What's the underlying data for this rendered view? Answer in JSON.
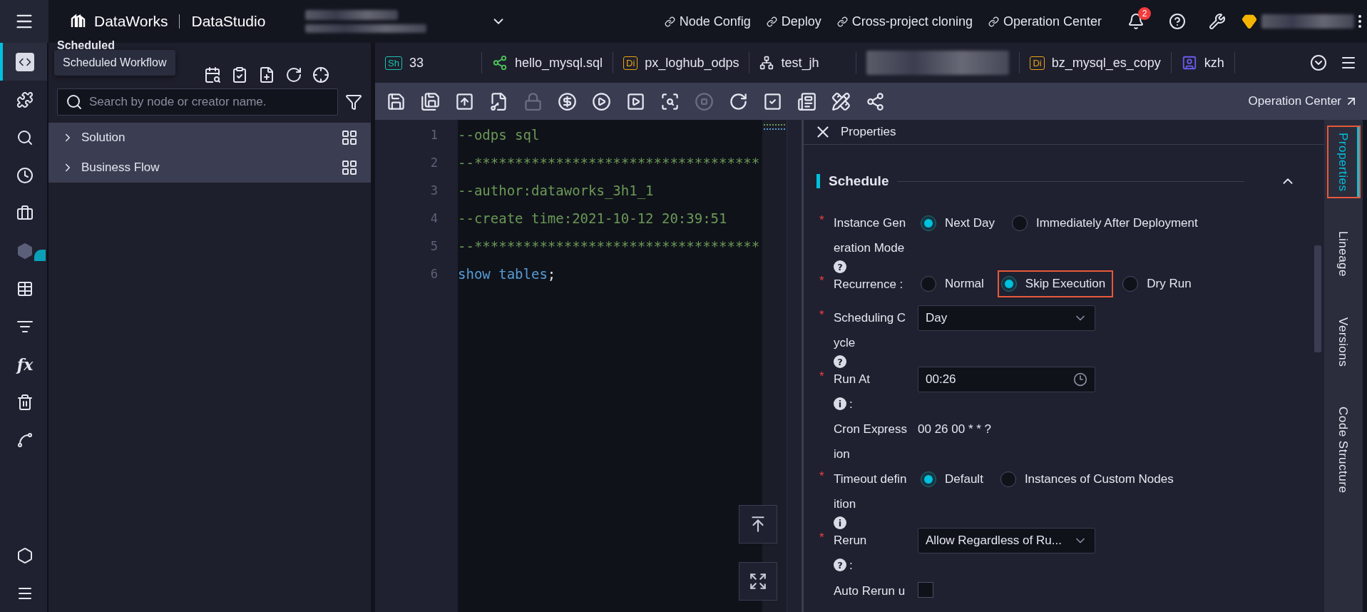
{
  "top_bar": {
    "brand": "DataWorks",
    "module": "DataStudio",
    "links": [
      "Node Config",
      "Deploy",
      "Cross-project cloning",
      "Operation Center"
    ],
    "notification_count": "2"
  },
  "activity_bar": [
    {
      "selected": true
    },
    {
      "selected": false
    },
    {
      "selected": false
    },
    {
      "selected": false
    },
    {
      "selected": false
    },
    {
      "selected": false,
      "disabled": true
    },
    {
      "selected": false
    },
    {
      "selected": false
    },
    {
      "selected": false,
      "glyph": "fx"
    },
    {
      "selected": false
    },
    {
      "selected": false
    }
  ],
  "workflow_panel": {
    "title": "Scheduled",
    "tooltip": "Scheduled Workflow",
    "search": {
      "placeholder": "Search by node or creator name."
    },
    "tree": [
      {
        "label": "Solution",
        "expanded": false
      },
      {
        "label": "Business Flow",
        "expanded": false
      }
    ]
  },
  "file_tabs": [
    {
      "kind": "shell",
      "badge": "Sh",
      "label": "33"
    },
    {
      "kind": "mysql",
      "label": "hello_mysql.sql"
    },
    {
      "kind": "di",
      "badge": "Di",
      "label": "px_loghub_odps"
    },
    {
      "kind": "flow",
      "label": "test_jh"
    },
    {
      "kind": "redacted"
    },
    {
      "kind": "di",
      "badge": "Di",
      "label": "bz_mysql_es_copy"
    },
    {
      "kind": "user",
      "label": "kzh"
    }
  ],
  "toolbar": {
    "buttons": [
      {
        "disabled": false
      },
      {
        "disabled": false
      },
      {
        "disabled": false
      },
      {
        "disabled": false
      },
      {
        "disabled": true
      },
      {
        "disabled": false
      },
      {
        "disabled": false
      },
      {
        "disabled": false
      },
      {
        "disabled": false
      },
      {
        "disabled": true
      },
      {
        "disabled": false
      },
      {
        "disabled": false
      },
      {
        "disabled": false
      },
      {
        "disabled": false
      },
      {
        "disabled": false
      }
    ],
    "link": "Operation Center"
  },
  "editor": {
    "lines": [
      {
        "number": "1",
        "tokens": [
          {
            "kind": "comment",
            "text": "--odps sql"
          }
        ]
      },
      {
        "number": "2",
        "tokens": [
          {
            "kind": "comment",
            "text": "--***********************************"
          }
        ]
      },
      {
        "number": "3",
        "tokens": [
          {
            "kind": "comment",
            "text": "--author:dataworks_3h1_1"
          }
        ]
      },
      {
        "number": "4",
        "tokens": [
          {
            "kind": "comment",
            "text": "--create time:2021-10-12 20:39:51"
          }
        ]
      },
      {
        "number": "5",
        "tokens": [
          {
            "kind": "comment",
            "text": "--***********************************"
          }
        ]
      },
      {
        "number": "6",
        "tokens": [
          {
            "kind": "keyword",
            "text": "show tables"
          },
          {
            "kind": "plain",
            "text": ";"
          }
        ]
      }
    ]
  },
  "properties": {
    "title": "Properties",
    "section": {
      "title": "Schedule",
      "expanded": true
    },
    "fields": [
      {
        "kind": "radio",
        "mark": "*",
        "label": "Instance Generation Mode",
        "help": "?",
        "options": [
          {
            "label": "Next Day",
            "selected": true,
            "highlighted": false
          },
          {
            "label": "Immediately After Deployment",
            "selected": false,
            "highlighted": false
          }
        ]
      },
      {
        "kind": "radio",
        "mark": "*",
        "label": "Recurrence :",
        "options": [
          {
            "label": "Normal",
            "selected": false,
            "highlighted": false
          },
          {
            "label": "Skip Execution",
            "selected": true,
            "highlighted": true
          },
          {
            "label": "Dry Run",
            "selected": false,
            "highlighted": false
          }
        ]
      },
      {
        "kind": "select",
        "mark": "*",
        "label": "Scheduling Cycle",
        "help": "?",
        "value": "Day"
      },
      {
        "kind": "time",
        "mark": "*",
        "label": "Run At",
        "help": "i",
        "suffix": ":",
        "value": "00:26"
      },
      {
        "kind": "text",
        "label": "Cron Expression",
        "value": "00 26 00 * * ?"
      },
      {
        "kind": "radio",
        "mark": "*",
        "label": "Timeout definition",
        "help": "i",
        "options": [
          {
            "label": "Default",
            "selected": true,
            "highlighted": false
          },
          {
            "label": "Instances of Custom Nodes",
            "selected": false,
            "highlighted": false
          }
        ]
      },
      {
        "kind": "select",
        "mark": "*",
        "label": "Rerun",
        "help": "?",
        "suffix": ":",
        "value": "Allow Regardless of Ru..."
      },
      {
        "kind": "checkbox",
        "label": "Auto Rerun u",
        "checked": false
      }
    ]
  },
  "side_tabs": [
    {
      "label": "Properties",
      "selected": true,
      "highlighted": true
    },
    {
      "label": "Lineage",
      "selected": false,
      "highlighted": false
    },
    {
      "label": "Versions",
      "selected": false,
      "highlighted": false
    },
    {
      "label": "Code Structure",
      "selected": false,
      "highlighted": false
    }
  ]
}
